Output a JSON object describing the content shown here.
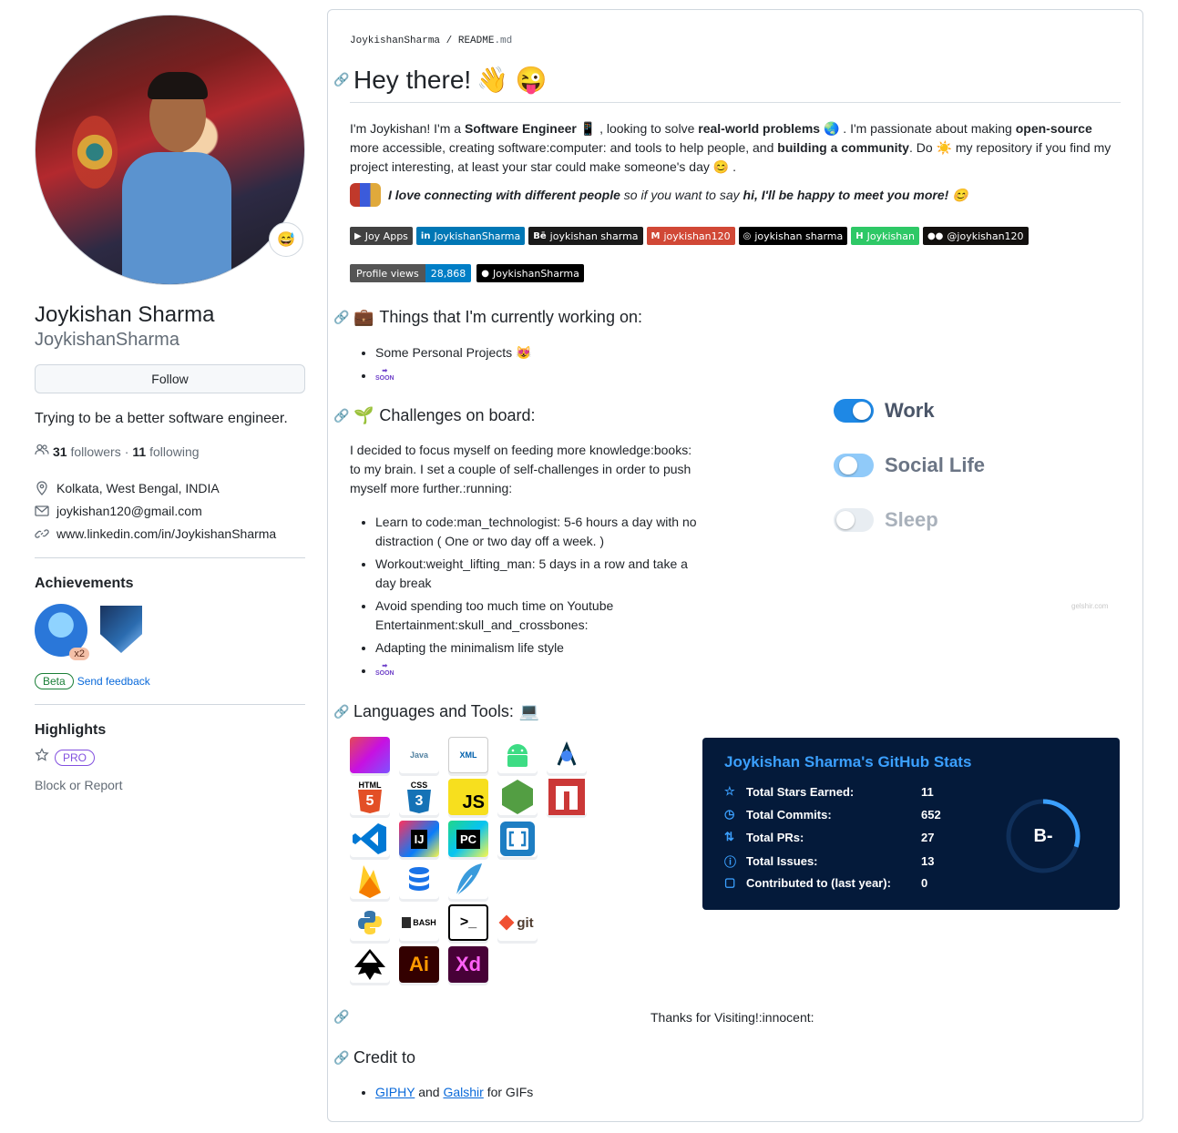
{
  "profile": {
    "full_name": "Joykishan Sharma",
    "username": "JoykishanSharma",
    "status_emoji": "😅",
    "follow_label": "Follow",
    "bio": "Trying to be a better software engineer.",
    "followers_count": "31",
    "followers_label": "followers",
    "following_count": "11",
    "following_label": "following",
    "dot": "·",
    "location": "Kolkata, West Bengal, INDIA",
    "email": "joykishan120@gmail.com",
    "website": "www.linkedin.com/in/JoykishanSharma",
    "achievements_title": "Achievements",
    "achievement_multiplier": "x2",
    "beta_label": "Beta",
    "send_feedback_label": "Send feedback",
    "highlights_title": "Highlights",
    "pro_label": "PRO",
    "block_label": "Block or Report"
  },
  "readme": {
    "path_user": "JoykishanSharma",
    "path_sep": " / ",
    "path_file": "README",
    "path_ext": ".md",
    "heading": "Hey there!",
    "heading_emoji": "👋 😜",
    "intro": {
      "p1": "I'm Joykishan! I'm a ",
      "b1": "Software Engineer",
      "p2": " 📱 , looking to solve ",
      "b2": "real-world problems",
      "p3": " 🌏 . I'm passionate about making ",
      "b3": "open-source",
      "p4": " more accessible, creating software:computer: and tools to help people, and ",
      "b4": "building a community",
      "p5": ". Do ☀️ my repository if you find my project interesting, at least your star could make someone's day 😊 ."
    },
    "love": {
      "b1": "I love connecting with different people",
      "p1": " so if you want to say ",
      "b2": "hi, I'll be happy to meet you more!",
      "emoji": "😊"
    },
    "badges": [
      {
        "label": "Joy Apps",
        "icon": "play-icon",
        "bg": "#414141"
      },
      {
        "label": "JoykishanSharma",
        "icon": "linkedin-icon",
        "bg": "#0077b5"
      },
      {
        "label": "joykishan sharma",
        "icon": "behance-icon",
        "bg": "#1a1a1a"
      },
      {
        "label": "joykishan120",
        "icon": "gmail-icon",
        "bg": "#d14836"
      },
      {
        "label": "joykishan sharma",
        "icon": "codepen-icon",
        "bg": "#000000"
      },
      {
        "label": "Joykishan",
        "icon": "hackerrank-icon",
        "bg": "#2ec866"
      },
      {
        "label": "@joykishan120",
        "icon": "medium-icon",
        "bg": "#12100e"
      }
    ],
    "profile_views_label": "Profile views",
    "profile_views_count": "28,868",
    "github_badge_label": "JoykishanSharma",
    "working_heading": "Things that I'm currently working on:",
    "working_emoji": "💼",
    "working_items": [
      "Some Personal Projects 😻"
    ],
    "soon_label": "SOON",
    "challenges_heading": "Challenges on board:",
    "challenges_emoji": "🌱",
    "challenges_para": "I decided to focus myself on feeding more knowledge:books: to my brain. I set a couple of self-challenges in order to push myself more further.:running:",
    "challenge_items": [
      "Learn to code:man_technologist: 5-6 hours a day with no distraction ( One or two day off a week. )",
      "Workout:weight_lifting_man: 5 days in a row and take a day break",
      "Avoid spending too much time on Youtube Entertainment:skull_and_crossbones:",
      "Adapting the minimalism life style"
    ],
    "toggles": [
      {
        "label": "Work",
        "on": true,
        "color": "#1e88e5",
        "text_color": "#4a5568"
      },
      {
        "label": "Social Life",
        "on": "half",
        "color": "#90caf9",
        "text_color": "#6b7585"
      },
      {
        "label": "Sleep",
        "on": false,
        "color": "#e8edf2",
        "text_color": "#a9b1bb"
      }
    ],
    "gif_credit": "gelshir.com",
    "languages_heading": "Languages and Tools:",
    "languages_emoji": "💻",
    "tool_icons": [
      [
        "kotlin-icon",
        "java-icon",
        "xml-icon",
        "android-icon",
        "android-studio-icon"
      ],
      [
        "html5-icon",
        "css3-icon",
        "javascript-icon",
        "nodejs-icon",
        "npm-icon"
      ],
      [
        "vscode-icon",
        "intellij-icon",
        "pycharm-icon",
        "brackets-icon"
      ],
      [
        "firebase-icon",
        "database-icon",
        "feather-icon"
      ],
      [
        "python-icon",
        "bash-icon",
        "terminal-icon",
        "git-icon"
      ],
      [
        "inkscape-icon",
        "illustrator-icon",
        "xd-icon"
      ]
    ],
    "tool_text": {
      "java": "Java",
      "xml": "XML",
      "html": "HTML",
      "css": "CSS",
      "js": "JS",
      "ij": "IJ",
      "pc": "PC",
      "bash": "BASH",
      "git": "git",
      "ai": "Ai",
      "xd": "Xd"
    },
    "stats": {
      "title": "Joykishan Sharma's GitHub Stats",
      "rows": [
        {
          "label": "Total Stars Earned:",
          "value": "11",
          "icon": "star-icon"
        },
        {
          "label": "Total Commits:",
          "value": "652",
          "icon": "history-icon"
        },
        {
          "label": "Total PRs:",
          "value": "27",
          "icon": "pull-request-icon"
        },
        {
          "label": "Total Issues:",
          "value": "13",
          "icon": "issue-icon"
        },
        {
          "label": "Contributed to (last year):",
          "value": "0",
          "icon": "repo-icon"
        }
      ],
      "grade": "B-",
      "grade_progress": 0.3,
      "accent": "#3ba0ff",
      "bg": "#041a3a"
    },
    "thanks": "Thanks for Visiting!:innocent:",
    "credit_heading": "Credit to",
    "credit": {
      "giphy": "GIPHY",
      "and": "and",
      "galshir": "Galshir",
      "tail": "for GIFs"
    }
  }
}
